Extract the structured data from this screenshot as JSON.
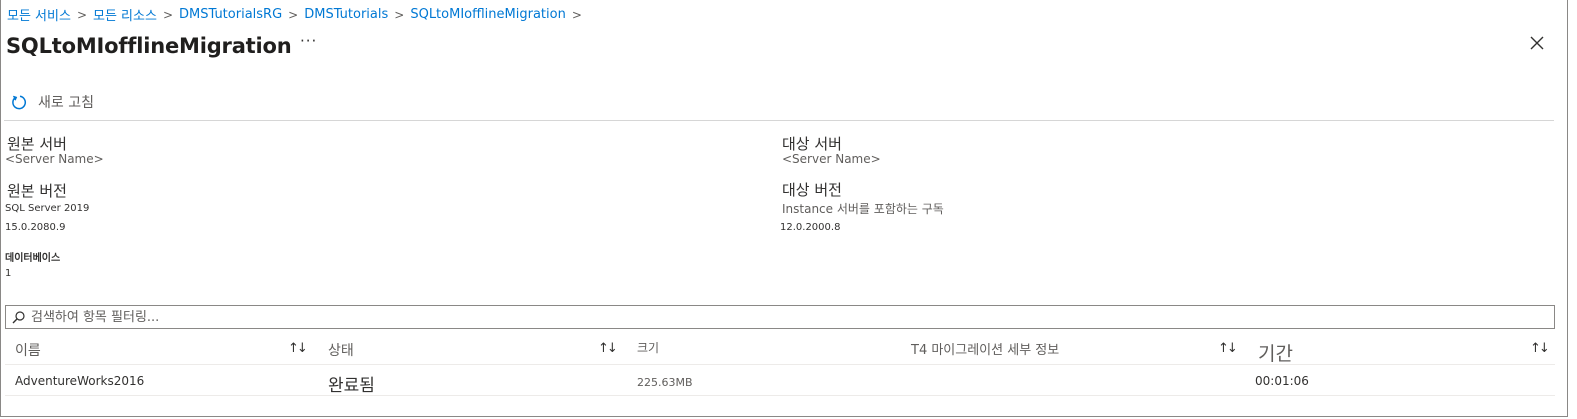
{
  "breadcrumb": {
    "items": [
      "모든 서비스",
      "모든 리소스",
      "DMSTutorialsRG",
      "DMSTutorials",
      "SQLtoMIofflineMigration"
    ],
    "separator": ">"
  },
  "header": {
    "title": "SQLtoMIofflineMigration",
    "more": "···",
    "close": "✕"
  },
  "toolbar": {
    "refresh_label": "새로 고침"
  },
  "details": {
    "source_server_label": "원본 서버",
    "source_server_value": "<Server Name>",
    "target_server_label": "대상 서버",
    "target_server_value": "<Server Name>",
    "source_version_label": "원본 버전",
    "source_version_name": "SQL Server 2019",
    "source_version_number": "15.0.2080.9",
    "target_version_label": "대상 버전",
    "target_version_name": "Instance 서버를 포함하는 구독",
    "target_version_number": "12.0.2000.8",
    "database_label": "데이터베이스",
    "database_count": "1"
  },
  "search": {
    "placeholder": "검색하여 항목 필터링..."
  },
  "table": {
    "columns": [
      "이름",
      "상태",
      "크기",
      "T4 마이그레이션 세부 정보",
      "기간"
    ],
    "sort_icon": "↑↓",
    "rows": [
      {
        "name": "AdventureWorks2016",
        "status": "완료됨",
        "size": "225.63MB",
        "details": "",
        "duration": "00:01:06"
      }
    ]
  },
  "colors": {
    "link": "#0078d4",
    "text": "#323130",
    "muted": "#605e5c"
  }
}
